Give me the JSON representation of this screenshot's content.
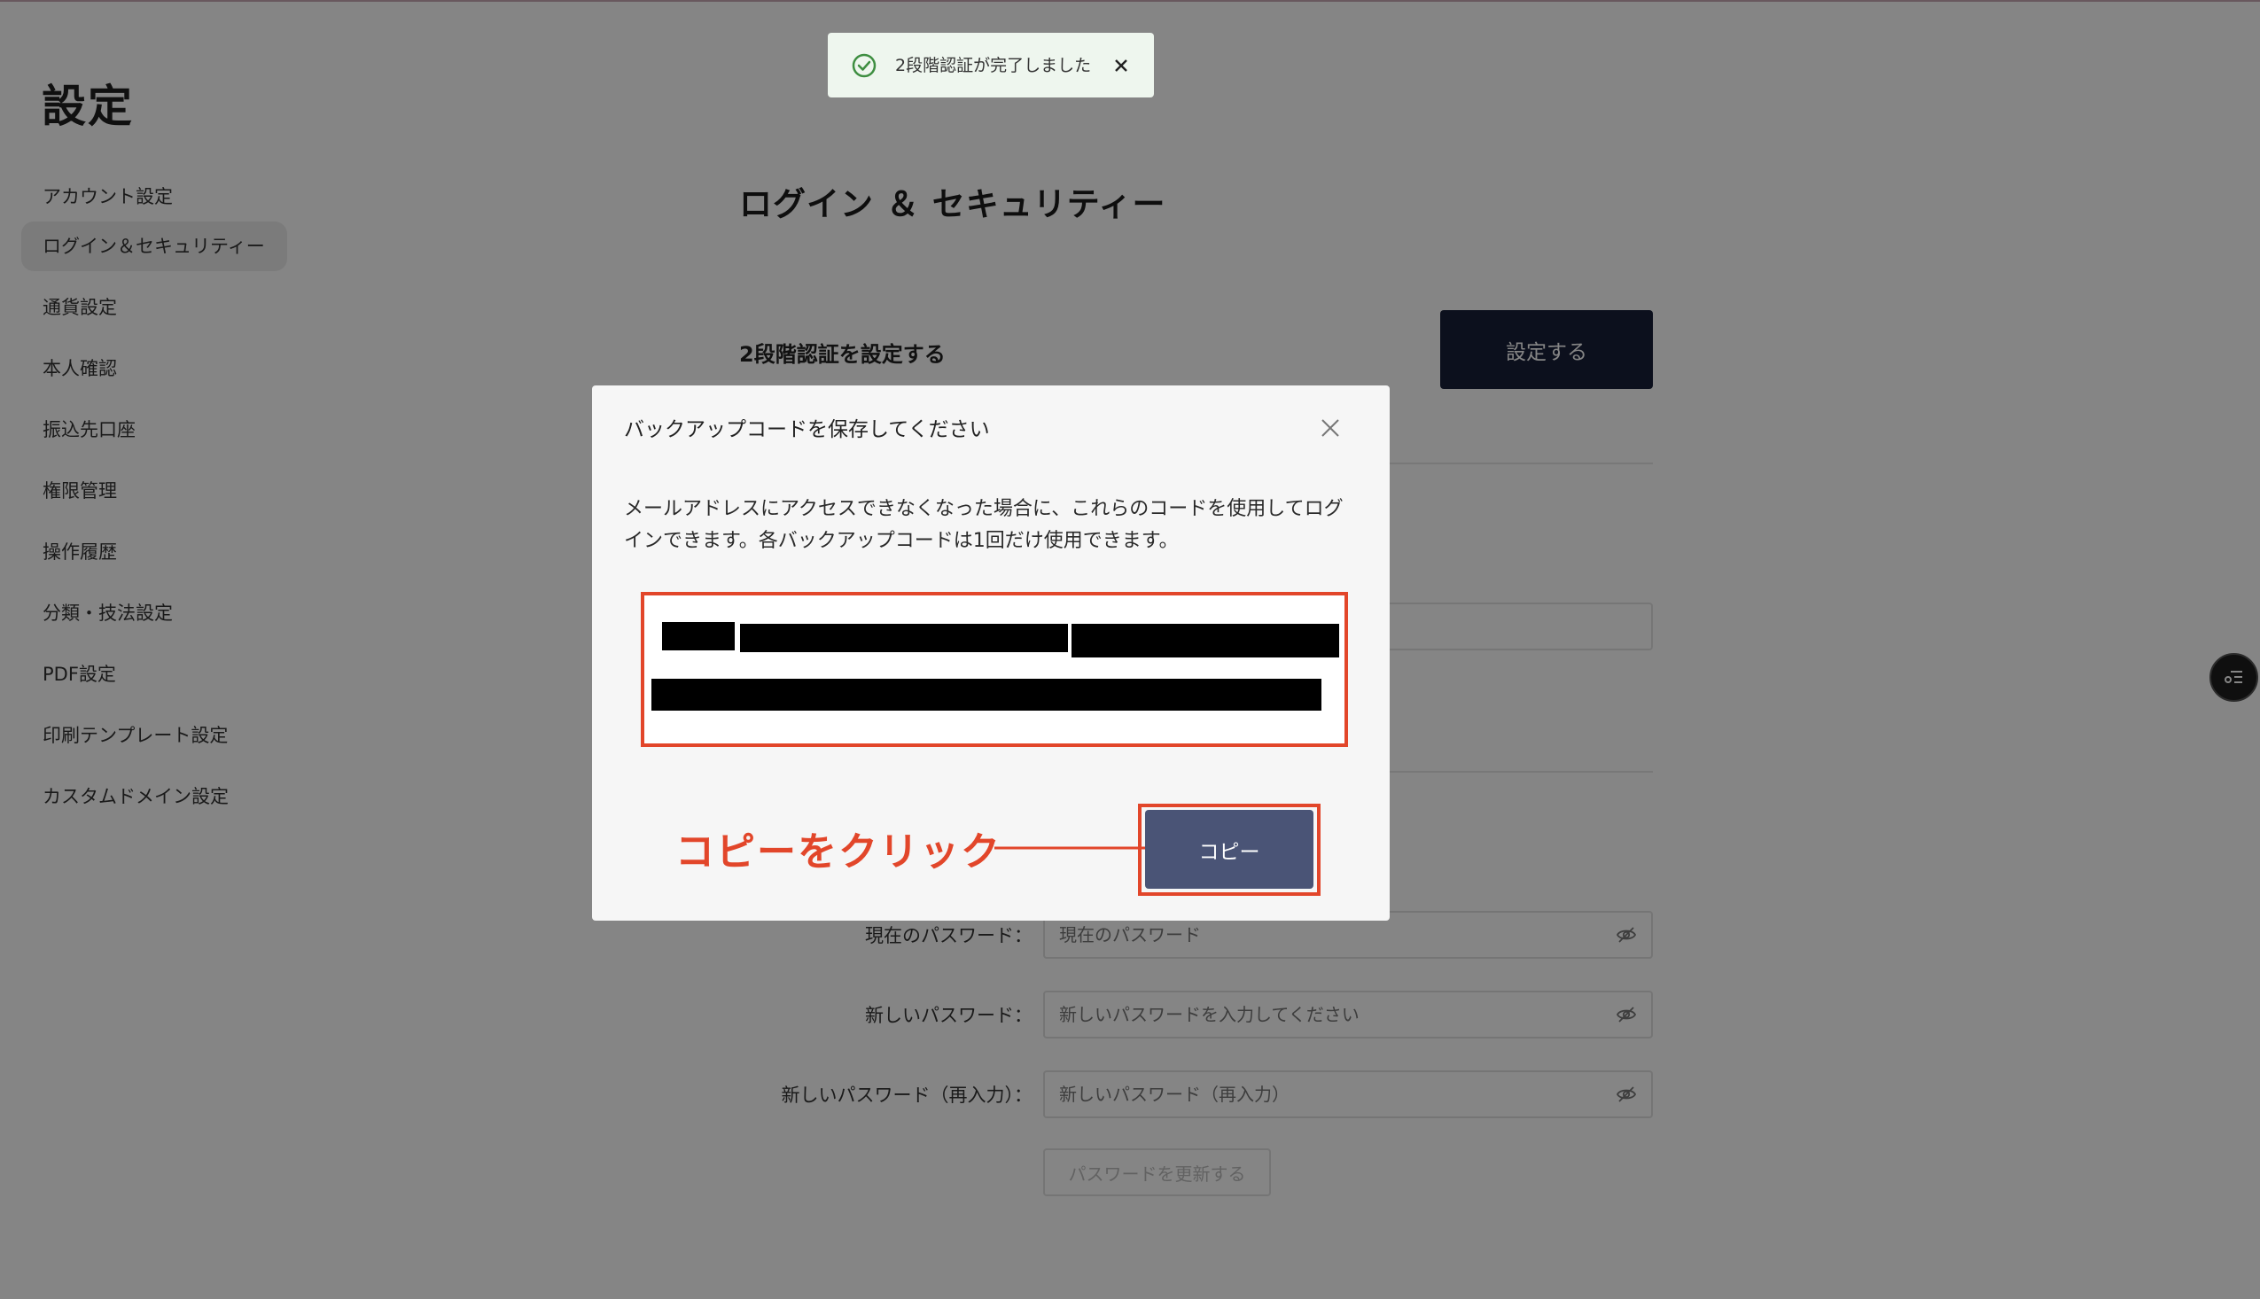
{
  "page": {
    "title": "設定",
    "sidebar": {
      "items": [
        {
          "label": "アカウント設定"
        },
        {
          "label": "ログイン＆セキュリティー",
          "active": true
        },
        {
          "label": "通貨設定"
        },
        {
          "label": "本人確認"
        },
        {
          "label": "振込先口座"
        },
        {
          "label": "権限管理"
        },
        {
          "label": "操作履歴"
        },
        {
          "label": "分類・技法設定"
        },
        {
          "label": "PDF設定"
        },
        {
          "label": "印刷テンプレート設定"
        },
        {
          "label": "カスタムドメイン設定"
        }
      ]
    },
    "main": {
      "section_title": "ログイン ＆ セキュリティー",
      "twofa_label": "2段階認証を設定する",
      "setup_button": "設定する",
      "password": {
        "current_label": "現在のパスワード：",
        "current_placeholder": "現在のパスワード",
        "new_label": "新しいパスワード：",
        "new_placeholder": "新しいパスワードを入力してください",
        "confirm_label": "新しいパスワード（再入力）：",
        "confirm_placeholder": "新しいパスワード（再入力）",
        "update_button": "パスワードを更新する"
      }
    }
  },
  "toast": {
    "message": "2段階認証が完了しました",
    "icon": "check-circle-icon",
    "color": "#3e8e41"
  },
  "modal": {
    "title": "バックアップコードを保存してください",
    "description": "メールアドレスにアクセスできなくなった場合に、これらのコードを使用してログインできます。各バックアップコードは1回だけ使用できます。",
    "codes_redacted": true,
    "copy_button": "コピー",
    "annotation": "コピーをクリック",
    "highlight_color": "#e2462a"
  },
  "colors": {
    "primary_button": "#182038",
    "copy_button": "#4a5476",
    "overlay": "rgba(0,0,0,0.48)"
  }
}
